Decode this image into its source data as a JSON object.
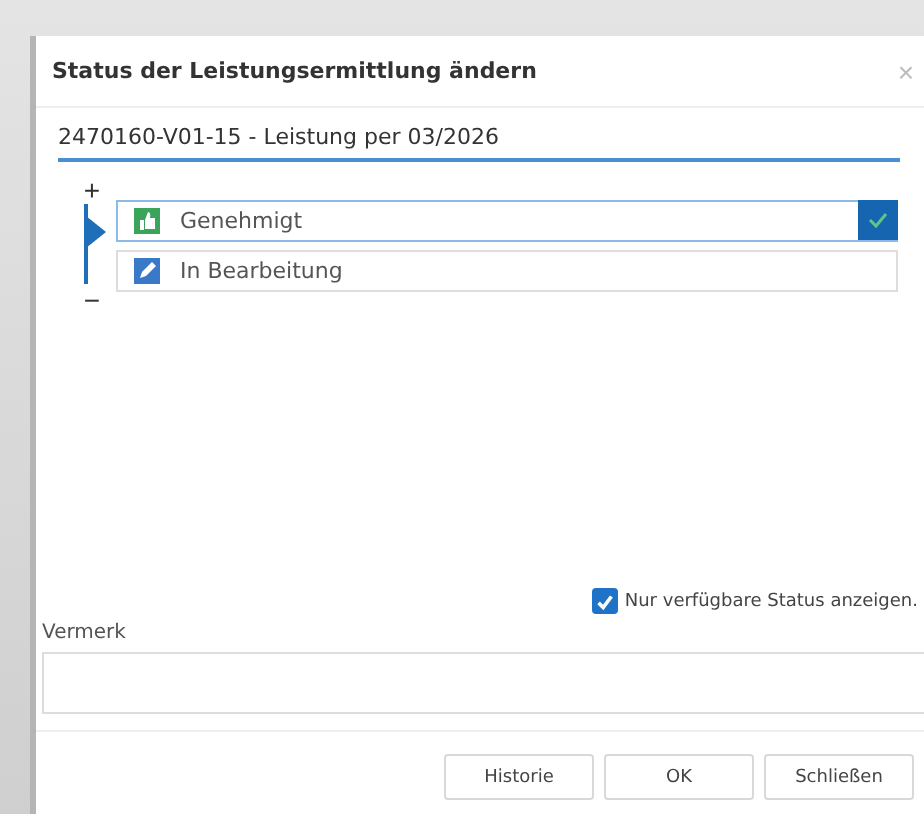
{
  "dialog": {
    "title": "Status der Leistungsermittlung ändern",
    "close": "×"
  },
  "record": "2470160-V01-15 - Leistung per 03/2026",
  "tree": {
    "expand": "+",
    "collapse": "−"
  },
  "statuses": [
    {
      "label": "Genehmigt",
      "kind": "approved",
      "selected": true
    },
    {
      "label": "In Bearbeitung",
      "kind": "editing",
      "selected": false
    }
  ],
  "filter": {
    "label": "Nur verfügbare Status anzeigen.",
    "checked": true
  },
  "note": {
    "label": "Vermerk"
  },
  "buttons": [
    "Historie",
    "OK",
    "Schließen"
  ]
}
